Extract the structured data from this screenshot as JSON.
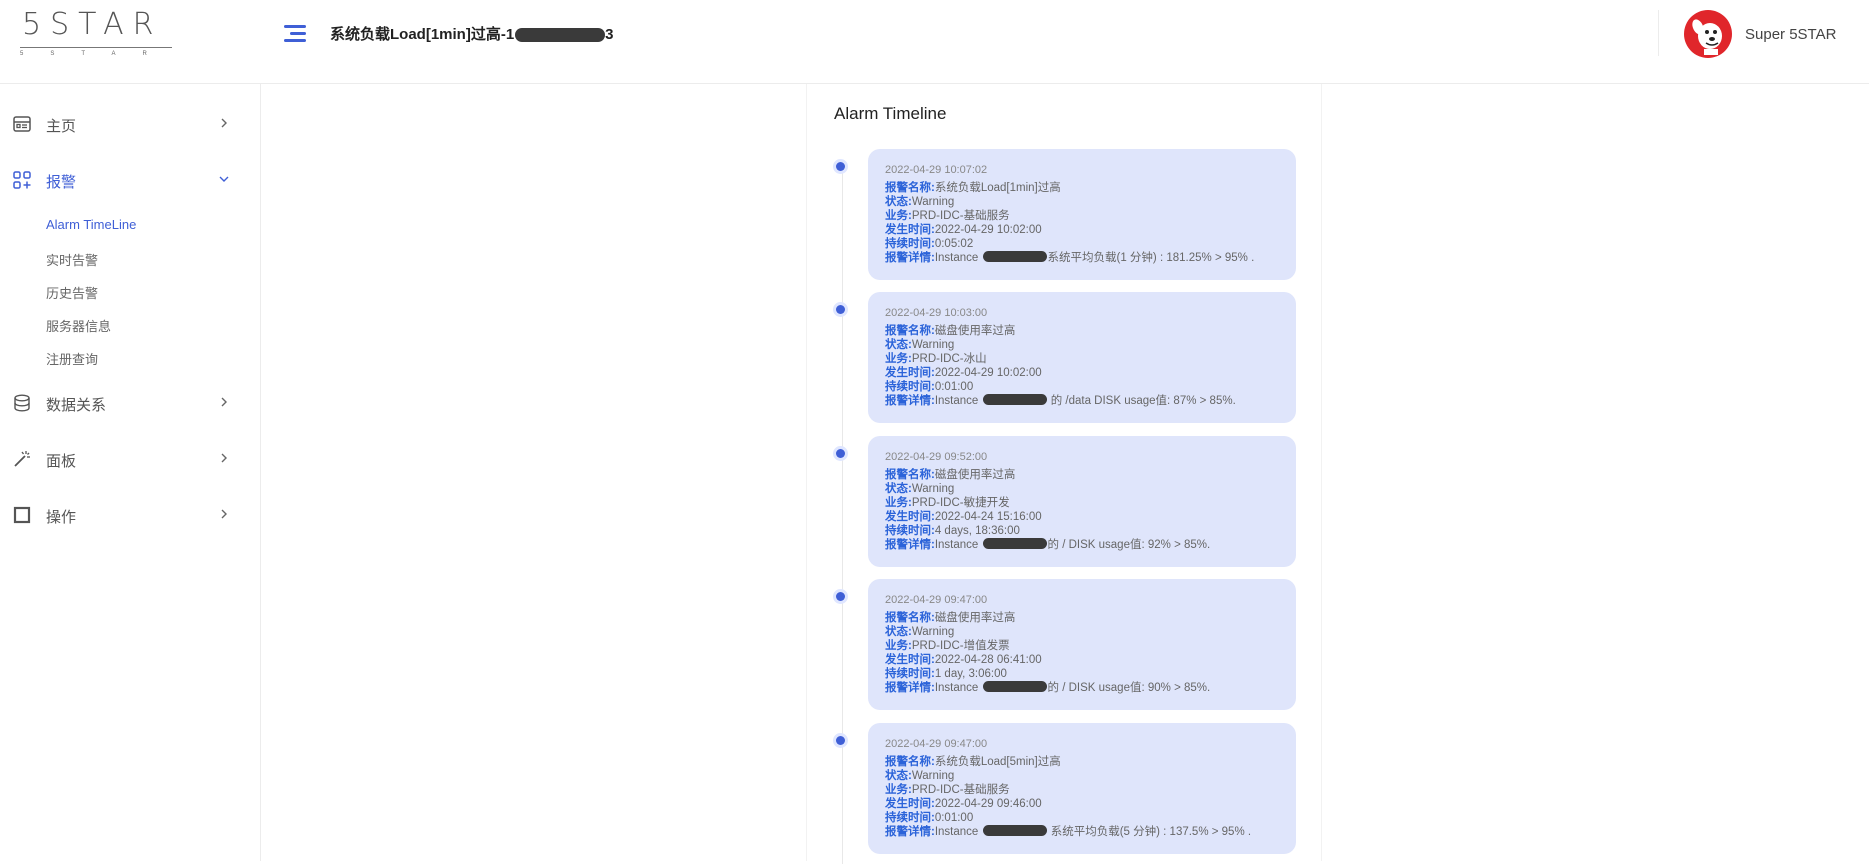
{
  "header": {
    "logo_main": "5STAR",
    "logo_sub": "5STAR",
    "title_prefix": "系统负载Load[1min]过高-1",
    "title_suffix": "3",
    "user_name": "Super 5STAR"
  },
  "sidebar": {
    "items": [
      {
        "label": "主页",
        "icon": "dashboard-icon"
      },
      {
        "label": "报警",
        "icon": "apps-add-icon"
      },
      {
        "label": "数据关系",
        "icon": "database-icon"
      },
      {
        "label": "面板",
        "icon": "magic-wand-icon"
      },
      {
        "label": "操作",
        "icon": "square-icon"
      }
    ],
    "sub_items": [
      "Alarm TimeLine",
      "实时告警",
      "历史告警",
      "服务器信息",
      "注册查询"
    ]
  },
  "timeline": {
    "title": "Alarm Timeline",
    "field_labels": {
      "name": "报警名称:",
      "status": "状态:",
      "business": "业务:",
      "occurred": "发生时间:",
      "duration": "持续时间:",
      "detail": "报警详情:"
    },
    "entries": [
      {
        "time": "2022-04-29 10:07:02",
        "name": "系统负载Load[1min]过高",
        "status": "Warning",
        "business": "PRD-IDC-基础服务",
        "occurred": "2022-04-29 10:02:00",
        "duration": "0:05:02",
        "detail_pre": "Instance ",
        "detail_post": "系统平均负载(1 分钟) : 181.25% > 95% ."
      },
      {
        "time": "2022-04-29 10:03:00",
        "name": "磁盘使用率过高",
        "status": "Warning",
        "business": "PRD-IDC-冰山",
        "occurred": "2022-04-29 10:02:00",
        "duration": "0:01:00",
        "detail_pre": "Instance ",
        "detail_post": " 的 /data DISK usage值: 87% > 85%."
      },
      {
        "time": "2022-04-29 09:52:00",
        "name": "磁盘使用率过高",
        "status": "Warning",
        "business": "PRD-IDC-敏捷开发",
        "occurred": "2022-04-24 15:16:00",
        "duration": "4 days, 18:36:00",
        "detail_pre": "Instance ",
        "detail_post": "的 / DISK usage值: 92% > 85%."
      },
      {
        "time": "2022-04-29 09:47:00",
        "name": "磁盘使用率过高",
        "status": "Warning",
        "business": "PRD-IDC-增值发票",
        "occurred": "2022-04-28 06:41:00",
        "duration": "1 day, 3:06:00",
        "detail_pre": "Instance ",
        "detail_post": "的 / DISK usage值: 90% > 85%."
      },
      {
        "time": "2022-04-29 09:47:00",
        "name": "系统负载Load[5min]过高",
        "status": "Warning",
        "business": "PRD-IDC-基础服务",
        "occurred": "2022-04-29 09:46:00",
        "duration": "0:01:00",
        "detail_pre": "Instance ",
        "detail_post": " 系统平均负载(5 分钟) : 137.5% > 95% ."
      }
    ]
  },
  "colors": {
    "accent": "#3f5fd6",
    "card_bg": "#dfe5fb",
    "field_label": "#2b63d9",
    "avatar_bg": "#e0262b"
  }
}
